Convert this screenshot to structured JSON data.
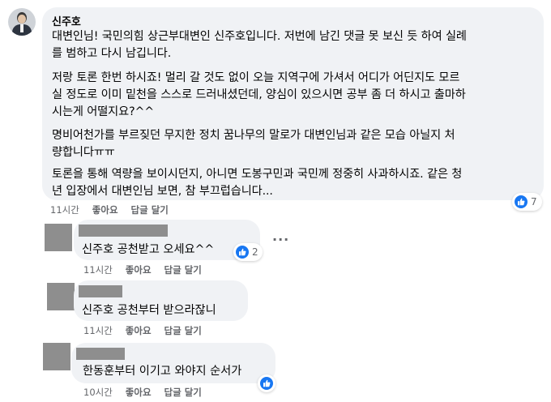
{
  "main_comment": {
    "author": "신주호",
    "paragraphs": [
      [
        "대변인님! 국민의힘 상근부대변인 신주호입니다. 저번에 남긴 댓글 못 보신 듯 하여 실례",
        "를 범하고 다시 남깁니다."
      ],
      [
        "저랑 토론 한번 하시죠! 멀리 갈 것도 없이 오늘 지역구에 가셔서 어디가 어딘지도 모르",
        "실 정도로 이미 밑천을 스스로 드러내셨던데, 양심이 있으시면 공부 좀 더 하시고 출마하",
        "시는게 어떨지요?^^"
      ],
      [
        "명비어천가를 부르짖던 무지한 정치 꿈나무의 말로가 대변인님과 같은 모습 아닐지 처",
        "량합니다ㅠㅠ"
      ],
      [
        "토론을 통해 역량을 보이시던지, 아니면 도봉구민과 국민께 정중히 사과하시죠. 같은 청",
        "년 입장에서 대변인님 보면, 참 부끄럽습니다..."
      ]
    ],
    "reaction_count": "7",
    "time": "11시간",
    "like_label": "좋아요",
    "reply_label": "답글 달기"
  },
  "replies": [
    {
      "text": "신주호 공천받고 오세요^^",
      "reaction_count": "2",
      "time": "11시간",
      "like_label": "좋아요",
      "reply_label": "답글 달기"
    },
    {
      "text": "신주호 공천부터 받으라잖니",
      "time": "11시간",
      "like_label": "좋아요",
      "reply_label": "답글 달기"
    },
    {
      "text": "한동훈부터 이기고 와야지 순서가",
      "time": "10시간",
      "like_label": "좋아요",
      "reply_label": "답글 달기"
    }
  ],
  "more_options": "···",
  "colors": {
    "bubble": "#f0f2f5",
    "like_blue": "#1877f2",
    "meta_gray": "#65676b",
    "redaction": "#8e8e8e"
  },
  "icons": {
    "reaction": "thumbs-up-icon",
    "more": "more-options-icon"
  }
}
